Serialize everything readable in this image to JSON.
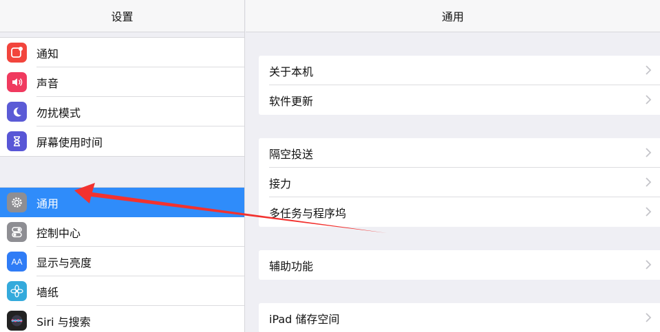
{
  "sidebar": {
    "title": "设置",
    "group1": [
      {
        "label": "通知",
        "icon": "notifications-icon",
        "color": "#f2453d"
      },
      {
        "label": "声音",
        "icon": "sound-icon",
        "color": "#f03a5f"
      },
      {
        "label": "勿扰模式",
        "icon": "moon-icon",
        "color": "#5b5bd6"
      },
      {
        "label": "屏幕使用时间",
        "icon": "hourglass-icon",
        "color": "#5856d6"
      }
    ],
    "group2": [
      {
        "label": "通用",
        "icon": "gear-icon",
        "color": "#8e8e93",
        "selected": true
      },
      {
        "label": "控制中心",
        "icon": "toggles-icon",
        "color": "#8e8e93"
      },
      {
        "label": "显示与亮度",
        "icon": "text-size-icon",
        "color": "#2f7cf6",
        "glyph": "AA"
      },
      {
        "label": "墙纸",
        "icon": "flower-icon",
        "color": "#34aadc"
      },
      {
        "label": "Siri 与搜索",
        "icon": "siri-icon",
        "color": "#222"
      }
    ]
  },
  "main": {
    "title": "通用",
    "card1": [
      "关于本机",
      "软件更新"
    ],
    "card2": [
      "隔空投送",
      "接力",
      "多任务与程序坞"
    ],
    "card3": [
      "辅助功能"
    ],
    "card4": [
      "iPad 储存空间"
    ]
  },
  "colors": {
    "selection": "#2f8cfa",
    "annotation_arrow": "#f2322f"
  }
}
